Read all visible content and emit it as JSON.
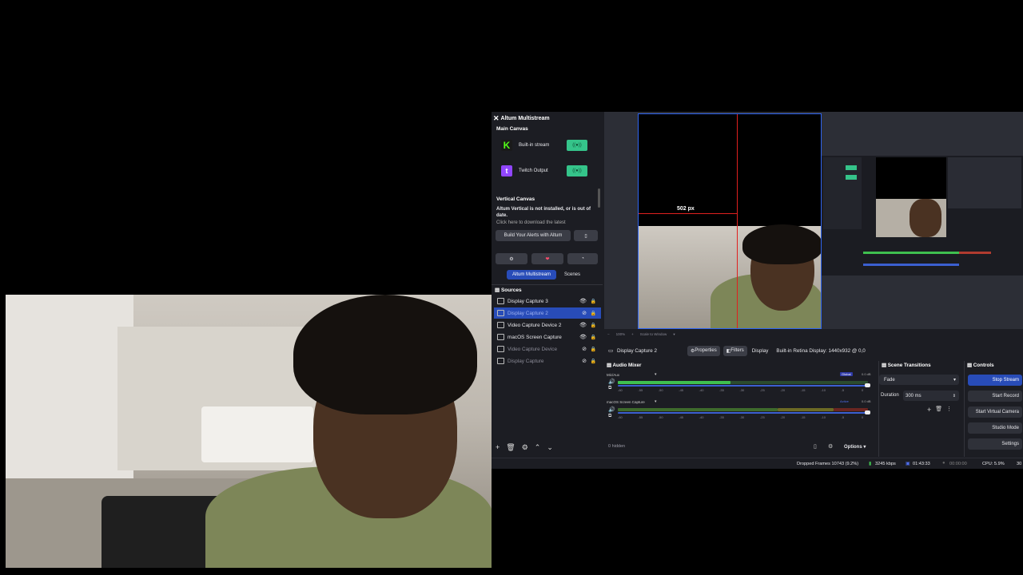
{
  "altum": {
    "title": "Altum Multistream",
    "main_canvas": "Main Canvas",
    "outputs": [
      {
        "name": "Built-in stream",
        "state": "((●))",
        "icon": "kick-icon",
        "color": "#53fc18"
      },
      {
        "name": "Twitch Output",
        "state": "((●))",
        "icon": "twitch-icon",
        "color": "#9146ff"
      }
    ],
    "vertical_canvas": "Vertical Canvas",
    "vertical_msg": "Altum Vertical is not installed, or is out of date.",
    "vertical_msg2": "Click here to download the latest",
    "alerts_button": "Build Your Alerts with Altum",
    "tabs": [
      "Altum Multistream",
      "Scenes"
    ]
  },
  "sources": {
    "title": "Sources",
    "items": [
      {
        "name": "Display Capture 3",
        "selected": false,
        "hidden": false
      },
      {
        "name": "Display Capture 2",
        "selected": true,
        "hidden": true
      },
      {
        "name": "Video Capture Device 2",
        "selected": false,
        "hidden": false
      },
      {
        "name": "macOS Screen Capture",
        "selected": false,
        "hidden": false
      },
      {
        "name": "Video Capture Device",
        "selected": false,
        "hidden": true
      },
      {
        "name": "Display Capture",
        "selected": false,
        "hidden": true
      }
    ]
  },
  "preview": {
    "measure": "502 px",
    "zoom": "100%",
    "scale": "Scale to Window"
  },
  "context_bar": {
    "source": "Display Capture 2",
    "properties": "Properties",
    "filters": "Filters",
    "display_label": "Display",
    "display_value": "Built-in Retina Display: 1440x932 @ 0,0"
  },
  "mixer": {
    "title": "Audio Mixer",
    "channels": [
      {
        "name": "Mic/Aux",
        "badge": "Global",
        "db": "0.0 dB",
        "level": 0.45
      },
      {
        "name": "macOS Screen Capture",
        "badge": "Active",
        "db": "0.0 dB",
        "level": 0.0
      }
    ],
    "ticks": [
      "-60",
      "-55",
      "-50",
      "-45",
      "-40",
      "-35",
      "-30",
      "-25",
      "-20",
      "-15",
      "-10",
      "-5",
      "0"
    ],
    "hidden": "0 hidden",
    "options": "Options"
  },
  "transitions": {
    "title": "Scene Transitions",
    "value": "Fade",
    "duration_label": "Duration",
    "duration_value": "300 ms"
  },
  "controls": {
    "title": "Controls",
    "buttons": [
      "Stop Stream",
      "Start Record",
      "Start Virtual Camera",
      "Studio Mode",
      "Settings"
    ]
  },
  "status": {
    "dropped": "Dropped Frames 10743 (9.2%)",
    "bitrate": "3245 kbps",
    "stream_time": "01:43:33",
    "record_time": "00:00:00",
    "cpu": "CPU: 5.9%",
    "fps": "30"
  },
  "colors": {
    "accent": "#284cb8",
    "toggle_on": "#35c48a",
    "guide": "#e0201f",
    "meter_green": "#3fbf4f"
  }
}
